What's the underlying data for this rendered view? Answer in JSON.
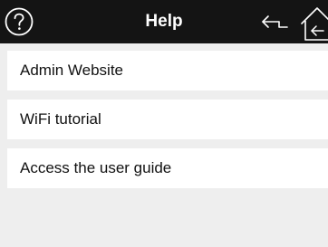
{
  "header": {
    "title": "Help",
    "icons": {
      "help": "question-circle-icon",
      "back": "back-arrow-icon",
      "home": "home-icon"
    }
  },
  "menu": {
    "items": [
      {
        "label": "Admin Website"
      },
      {
        "label": "WiFi tutorial"
      },
      {
        "label": "Access the user guide"
      }
    ]
  },
  "colors": {
    "header_background": "#141414",
    "header_text": "#ffffff",
    "page_background": "#eeeeee",
    "item_background": "#ffffff"
  }
}
